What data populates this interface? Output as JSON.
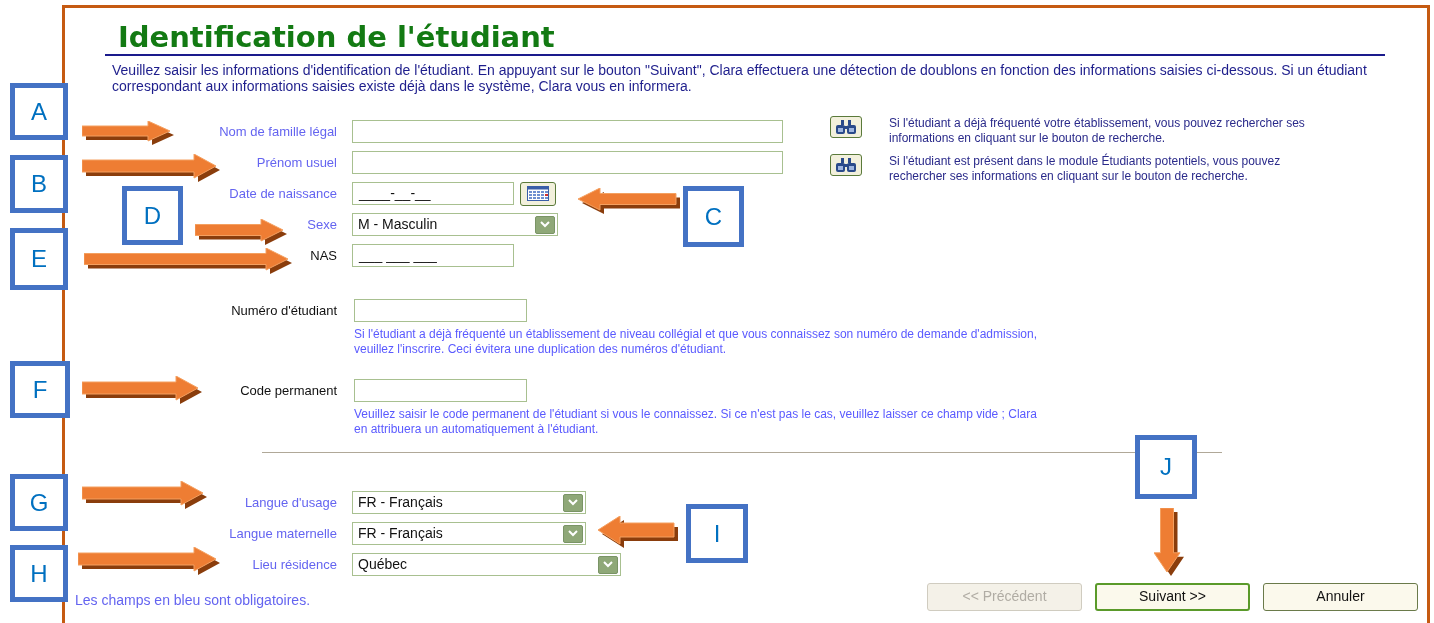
{
  "title": "Identification de l'étudiant",
  "intro": "Veuillez saisir les informations d'identification de l'étudiant. En appuyant sur le bouton \"Suivant\", Clara effectuera une détection de doublons en fonction des informations saisies ci-dessous. Si un étudiant correspondant aux informations saisies existe déjà dans le système, Clara vous en informera.",
  "identity_fields": [
    {
      "kind": "text",
      "label": "Nom de famille légal",
      "required": true
    },
    {
      "kind": "text",
      "label": "Prénom usuel",
      "required": true
    },
    {
      "kind": "date",
      "label": "Date de naissance",
      "required": true,
      "value": "____-__-__"
    },
    {
      "kind": "select",
      "label": "Sexe",
      "required": true,
      "value": "M - Masculin"
    },
    {
      "kind": "masked",
      "label": "NAS",
      "required": false,
      "value": "___ ___ ___"
    }
  ],
  "search_hints": [
    {
      "text": "Si l'étudiant a déjà fréquenté votre établissement, vous pouvez rechercher ses informations en cliquant sur le bouton de recherche."
    },
    {
      "text": "Si l'étudiant est présent dans le module Étudiants potentiels, vous pouvez rechercher ses informations en cliquant sur le bouton de recherche."
    }
  ],
  "number_fields": [
    {
      "label": "Numéro d'étudiant",
      "required": false,
      "help": "Si l'étudiant a déjà fréquenté un établissement de niveau collégial et que vous connaissez son numéro de demande d'admission, veuillez l'inscrire. Ceci évitera une duplication des numéros d'étudiant."
    },
    {
      "label": "Code permanent",
      "required": false,
      "help": "Veuillez saisir le code permanent de l'étudiant si vous le connaissez. Si ce n'est pas le cas, veuillez laisser ce champ vide ; Clara en attribuera un automatiquement à l'étudiant."
    }
  ],
  "other_fields": [
    {
      "label": "Langue d'usage",
      "required": true,
      "value": "FR - Français"
    },
    {
      "label": "Langue maternelle",
      "required": true,
      "value": "FR - Français"
    },
    {
      "label": "Lieu résidence",
      "required": true,
      "value": "Québec"
    }
  ],
  "required_note": "Les champs en bleu sont obligatoires.",
  "buttons": [
    {
      "label": "<< Précédent",
      "disabled": true,
      "default": false
    },
    {
      "label": "Suivant >>",
      "disabled": false,
      "default": true
    },
    {
      "label": "Annuler",
      "disabled": false,
      "default": false
    }
  ],
  "callouts": [
    {
      "letter": "A"
    },
    {
      "letter": "B"
    },
    {
      "letter": "D"
    },
    {
      "letter": "C"
    },
    {
      "letter": "E"
    },
    {
      "letter": "F"
    },
    {
      "letter": "G"
    },
    {
      "letter": "I"
    },
    {
      "letter": "H"
    },
    {
      "letter": "J"
    }
  ]
}
